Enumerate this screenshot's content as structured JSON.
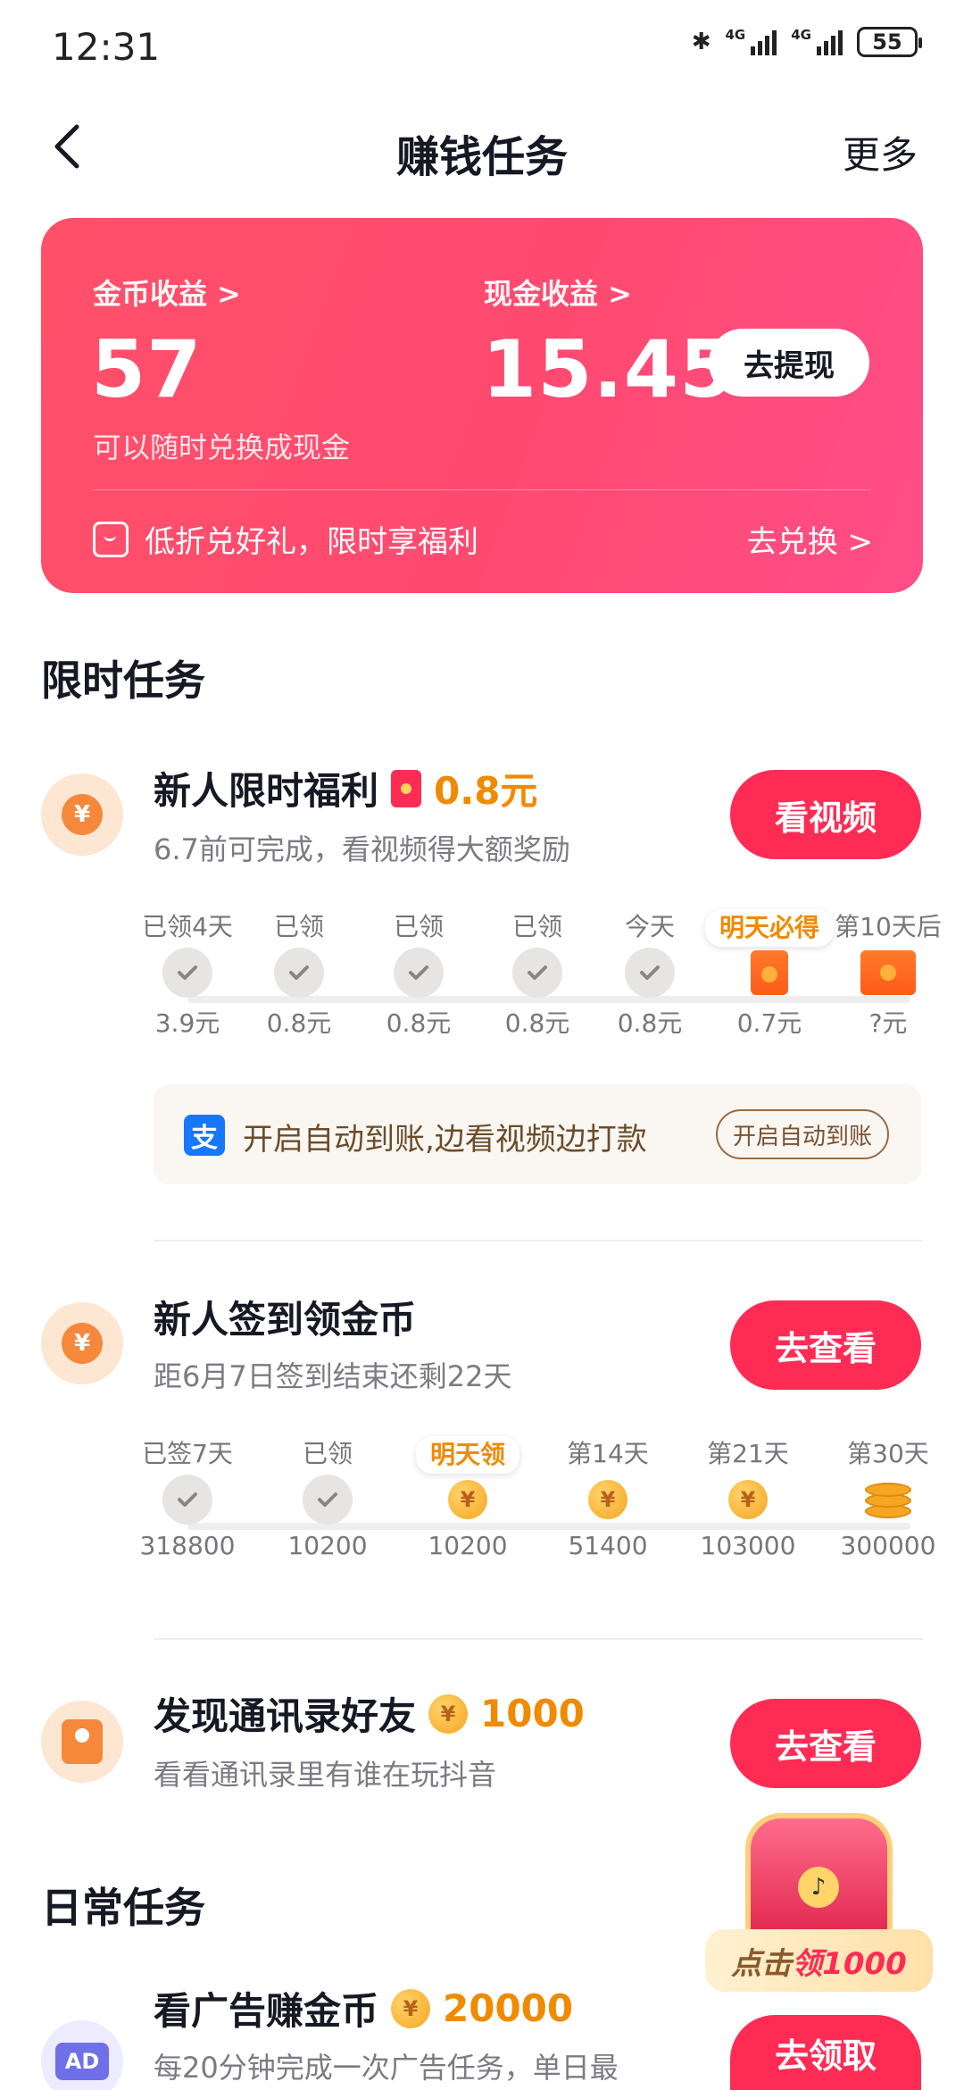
{
  "status": {
    "time": "12:31",
    "net1": "4G",
    "net2": "4G",
    "battery": "55"
  },
  "nav": {
    "title": "赚钱任务",
    "more": "更多"
  },
  "earnings": {
    "coin_label": "金币收益 >",
    "coin_value": "57",
    "coin_sub": "可以随时兑换成现金",
    "cash_label": "现金收益 >",
    "cash_value": "15.45",
    "withdraw": "去提现",
    "promo": "低折兑好礼，限时享福利",
    "exchange": "去兑换 >"
  },
  "sections": {
    "limited": "限时任务",
    "daily": "日常任务"
  },
  "task_newbie": {
    "title": "新人限时福利",
    "reward": "0.8元",
    "desc": "6.7前可完成，看视频得大额奖励",
    "button": "看视频",
    "steps": [
      {
        "top": "已领4天",
        "bottom": "3.9元",
        "state": "done"
      },
      {
        "top": "已领",
        "bottom": "0.8元",
        "state": "done"
      },
      {
        "top": "已领",
        "bottom": "0.8元",
        "state": "done"
      },
      {
        "top": "已领",
        "bottom": "0.8元",
        "state": "done"
      },
      {
        "top": "今天",
        "bottom": "0.8元",
        "state": "done"
      },
      {
        "top": "明天必得",
        "bottom": "0.7元",
        "state": "next"
      },
      {
        "top": "第10天后",
        "bottom": "?元",
        "state": "future"
      }
    ]
  },
  "alipay": {
    "logo": "支",
    "text": "开启自动到账,边看视频边打款",
    "button": "开启自动到账"
  },
  "task_checkin": {
    "title": "新人签到领金币",
    "desc": "距6月7日签到结束还剩22天",
    "button": "去查看",
    "steps": [
      {
        "top": "已签7天",
        "bottom": "318800",
        "state": "done"
      },
      {
        "top": "已领",
        "bottom": "10200",
        "state": "done"
      },
      {
        "top": "明天领",
        "bottom": "10200",
        "state": "next"
      },
      {
        "top": "第14天",
        "bottom": "51400",
        "state": "coin"
      },
      {
        "top": "第21天",
        "bottom": "103000",
        "state": "coin"
      },
      {
        "top": "第30天",
        "bottom": "300000",
        "state": "stack"
      }
    ]
  },
  "task_contacts": {
    "title": "发现通讯录好友",
    "reward": "1000",
    "desc": "看看通讯录里有谁在玩抖音",
    "button": "去查看"
  },
  "task_ads": {
    "title": "看广告赚金币",
    "reward": "20000",
    "desc": "每20分钟完成一次广告任务，单日最",
    "button": "去领取",
    "icon_text": "AD"
  },
  "chest": {
    "prefix": "点击",
    "highlight": "领1000"
  },
  "icons": {
    "yen": "¥"
  },
  "colors": {
    "accent": "#fe2c55",
    "card_gradient_start": "#ff5069",
    "card_gradient_end": "#ff4d88",
    "reward_orange": "#f08a00"
  }
}
